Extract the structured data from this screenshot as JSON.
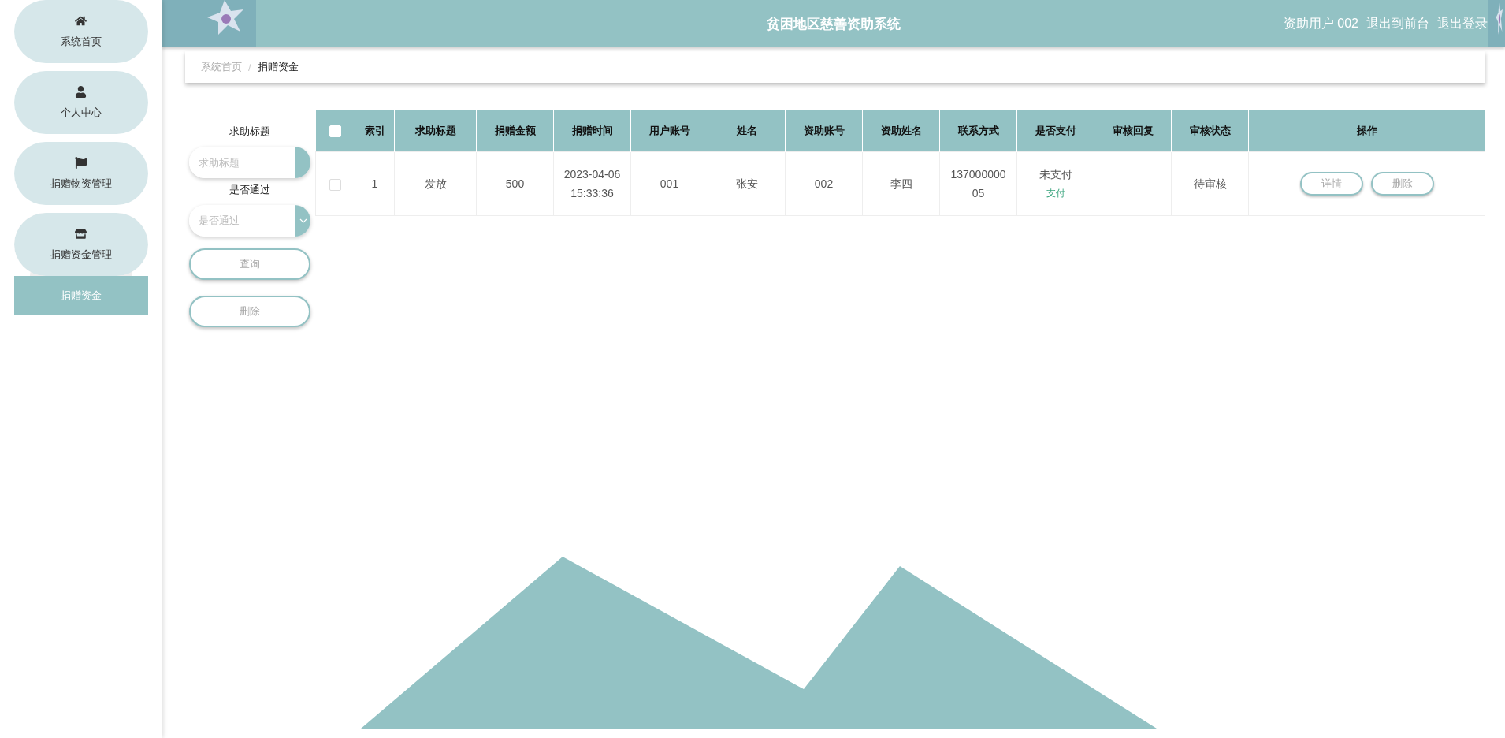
{
  "sidebar": {
    "items": [
      {
        "label": "系统首页"
      },
      {
        "label": "个人中心"
      },
      {
        "label": "捐赠物资管理"
      },
      {
        "label": "捐赠资金管理",
        "expanded": true,
        "children": [
          {
            "label": "捐赠资金",
            "selected": true
          }
        ]
      }
    ]
  },
  "header": {
    "title": "贫困地区慈善资助系统",
    "user": "资助用户 002",
    "links": [
      "退出到前台",
      "退出登录"
    ]
  },
  "breadcrumb": {
    "items": [
      "系统首页",
      "捐赠资金"
    ],
    "separator": "/"
  },
  "filters": [
    {
      "kind": "input",
      "label": "求助标题",
      "placeholder": "求助标题"
    },
    {
      "kind": "select",
      "label": "是否通过",
      "placeholder": "是否通过"
    }
  ],
  "filter_buttons": [
    "查询",
    "删除"
  ],
  "table": {
    "select_all": {
      "checked": false
    },
    "columns": [
      "索引",
      "求助标题",
      "捐赠金额",
      "捐赠时间",
      "用户账号",
      "姓名",
      "资助账号",
      "资助姓名",
      "联系方式",
      "是否支付",
      "审核回复",
      "审核状态",
      "操作"
    ],
    "rows": [
      {
        "checked": false,
        "index": "1",
        "title": "发放",
        "amount": "500",
        "time": "2023-04-06 15:33:36",
        "user_account": "001",
        "name": "张安",
        "donor_account": "002",
        "donor_name": "李四",
        "contact": "13700000005",
        "payment": {
          "status": "未支付",
          "action": "支付"
        },
        "review_status": "待审核",
        "actions": [
          "详情",
          "删除"
        ]
      }
    ]
  }
}
